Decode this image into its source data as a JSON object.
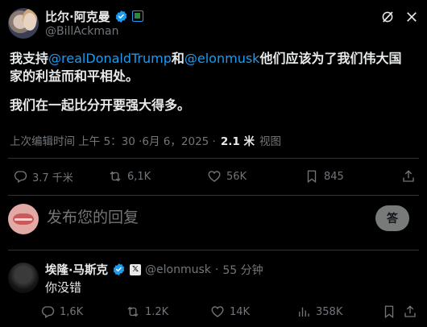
{
  "post": {
    "author": {
      "display_name": "比尔·阿克曼",
      "handle": "@BillAckman"
    },
    "body": {
      "line1_prefix": "我支持",
      "mention1": "@realDonaldTrump",
      "line1_mid": "和",
      "mention2": "@elonmusk",
      "line1_suffix": "他们应该为了我们伟大国家的利益而和平相处。",
      "line2": "我们在一起比分开要强大得多。"
    },
    "meta": {
      "timestamp": "上次编辑时间 上午 5：30 ·6月 6，2025 ·",
      "views_count": "2.1 米",
      "views_label": "视图"
    },
    "actions": {
      "replies": "3.7 千米",
      "reposts": "6,1K",
      "likes": "56K",
      "bookmarks": "845"
    }
  },
  "composer": {
    "placeholder": "发布您的回复",
    "button_label": "答"
  },
  "reply": {
    "author": {
      "display_name": "埃隆·马斯克",
      "affiliate_badge": "𝕏",
      "handle": "@elonmusk",
      "separator": "·",
      "time": "55 分钟"
    },
    "text": "你没错",
    "actions": {
      "replies": "1,6K",
      "reposts": "1.2K",
      "likes": "14K",
      "views": "358K"
    }
  },
  "colors": {
    "background": "#000000",
    "text_primary": "#e7e9ea",
    "text_secondary": "#71767b",
    "accent": "#1d9bf0",
    "divider": "#2f3336"
  }
}
